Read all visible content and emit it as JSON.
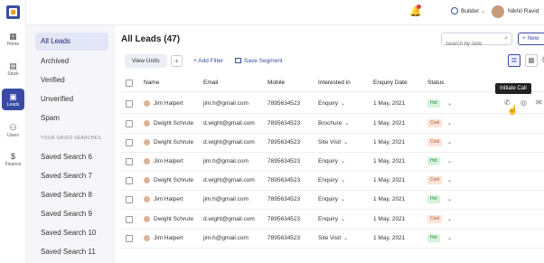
{
  "topbar": {
    "builder_label": "Builder",
    "user_name": "Nikhil Ravid"
  },
  "rail": {
    "items": [
      {
        "label": "Home",
        "icon": "home-grid-icon"
      },
      {
        "label": "Stock",
        "icon": "stock-icon"
      },
      {
        "label": "Leads",
        "icon": "leads-icon"
      },
      {
        "label": "Users",
        "icon": "users-icon"
      },
      {
        "label": "Finance",
        "icon": "finance-icon"
      }
    ]
  },
  "sidebar": {
    "items": [
      "All Leads",
      "Archived",
      "Verified",
      "Unverified",
      "Spam"
    ],
    "section_title": "YOUR SAVED SEARCHES",
    "saved": [
      "Saved Search 6",
      "Saved Search 7",
      "Saved Search 8",
      "Saved Search 9",
      "Saved Search 10",
      "Saved Search 11"
    ]
  },
  "main": {
    "title": "All Leads (47)",
    "search_placeholder": "Search by date",
    "new_label": "+ New",
    "view_units": "View Units",
    "add_filter": "+ Add Filter",
    "save_segment": "Save Segment"
  },
  "table": {
    "headers": [
      "Name",
      "Email",
      "Mobile",
      "Interested in",
      "Enquiry Date",
      "Status"
    ],
    "rows": [
      {
        "name": "Jim Halpert",
        "email": "jim.h@gmail.com",
        "mobile": "7895634523",
        "interest": "Enquiry",
        "date": "1 May, 2021",
        "status": "Hot"
      },
      {
        "name": "Dwight Schrute",
        "email": "d.wight@gmail.com",
        "mobile": "7895634523",
        "interest": "Brochure",
        "date": "1 May, 2021",
        "status": "Cool"
      },
      {
        "name": "Dwight Schrute",
        "email": "d.wight@gmail.com",
        "mobile": "7895634523",
        "interest": "Site Visit",
        "date": "1 May, 2021",
        "status": "Cool"
      },
      {
        "name": "Jim Halpert",
        "email": "jim.h@gmail.com",
        "mobile": "7895634523",
        "interest": "Enquiry",
        "date": "1 May, 2021",
        "status": "Hot"
      },
      {
        "name": "Dwight Schrute",
        "email": "d.wight@gmail.com",
        "mobile": "7895634523",
        "interest": "Enquiry",
        "date": "1 May, 2021",
        "status": "Cool"
      },
      {
        "name": "Jim Halpert",
        "email": "jim.h@gmail.com",
        "mobile": "7895634523",
        "interest": "Enquiry",
        "date": "1 May, 2021",
        "status": "Hot"
      },
      {
        "name": "Dwight Schrute",
        "email": "d.wight@gmail.com",
        "mobile": "7895634523",
        "interest": "Enquiry",
        "date": "1 May, 2021",
        "status": "Cool"
      },
      {
        "name": "Jim Halpert",
        "email": "jim.h@gmail.com",
        "mobile": "7895634523",
        "interest": "Site Visit",
        "date": "1 May, 2021",
        "status": "Hot"
      }
    ]
  },
  "tooltip": "Initiate Call",
  "colors": {
    "accent": "#3a4ba6",
    "hot_bg": "#d6f3dc",
    "cool_bg": "#fbe3d9"
  }
}
